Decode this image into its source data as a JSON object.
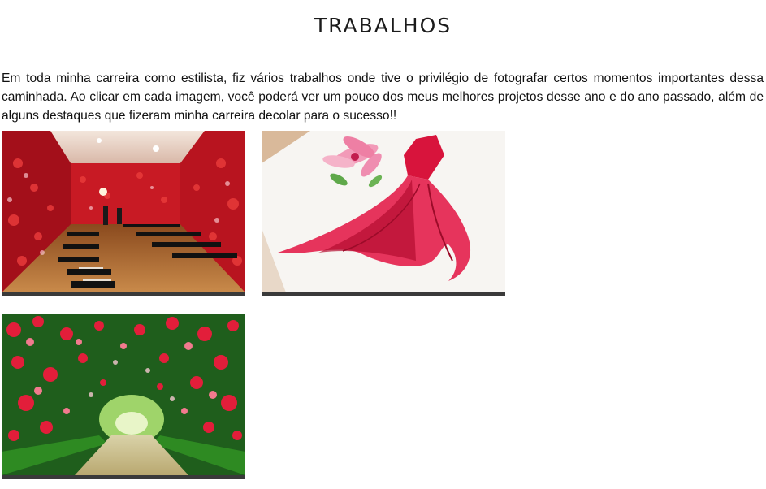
{
  "page": {
    "title": "TRABALHOS",
    "intro": "Em toda minha carreira como estilista, fiz vários trabalhos onde tive o privilégio de fotografar certos momentos importantes dessa caminhada. Ao clicar em cada imagem, você poderá ver um pouco dos meus melhores projetos desse ano e do ano passado, além de alguns destaques que fizeram minha carreira decolar para o sucesso!!"
  },
  "gallery": {
    "items": [
      {
        "icon": "flower-wall-runway-photo"
      },
      {
        "icon": "red-dress-sketch-photo"
      },
      {
        "icon": "rose-garden-tunnel-photo"
      }
    ]
  },
  "colors": {
    "text": "#111111",
    "card_bar": "#3a3a3a",
    "accent_red": "#d6202c",
    "accent_pink": "#e0245e",
    "garden_green": "#2f8a2a"
  }
}
